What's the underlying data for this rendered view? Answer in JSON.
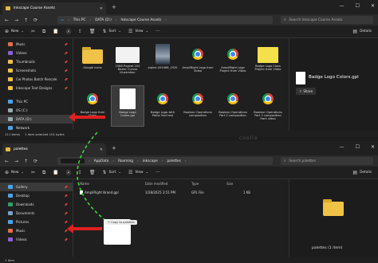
{
  "window1": {
    "tab_title": "Inkscape Course Assets",
    "breadcrumb": [
      "This PC",
      "DATA (D:)",
      "Inkscape Course Assets"
    ],
    "search_placeholder": "Search Inkscape Course Assets",
    "toolbar": {
      "new": "New",
      "sort": "Sort",
      "view": "View",
      "details": "Details"
    },
    "sidebar": [
      {
        "label": "Music",
        "icon": "music-folder-icon",
        "color": "#e36f46",
        "pinned": true
      },
      {
        "label": "Videos",
        "icon": "videos-folder-icon",
        "color": "#8a63d2",
        "pinned": true
      },
      {
        "label": "Thumbnails",
        "icon": "folder-icon",
        "color": "#f0c346",
        "pinned": true
      },
      {
        "label": "Screenshots",
        "icon": "folder-icon",
        "color": "#f0c346",
        "pinned": true
      },
      {
        "label": "Cw Photos Batch Rescale",
        "icon": "folder-icon",
        "color": "#f0c346",
        "pinned": true
      },
      {
        "label": "Inkscape Text Designs",
        "icon": "folder-icon",
        "color": "#f0c346",
        "pinned": true
      },
      {
        "label": "",
        "icon": "",
        "color": "",
        "pinned": false
      },
      {
        "label": "This PC",
        "icon": "pc-icon",
        "color": "#4aa3e8",
        "pinned": false
      },
      {
        "label": "OS (C:)",
        "icon": "drive-icon",
        "color": "#9aa",
        "pinned": false
      },
      {
        "label": "DATA (D:)",
        "icon": "drive-icon",
        "color": "#9aa",
        "pinned": false,
        "selected": true
      },
      {
        "label": "Network",
        "icon": "network-icon",
        "color": "#4aa3e8",
        "pinned": false
      }
    ],
    "files": [
      {
        "name": "Google Icons",
        "type": "folder",
        "selected": false
      },
      {
        "name": "1968 Pugeot 204 Bezier Curves Illustration",
        "type": "paper",
        "selected": false
      },
      {
        "name": "alpine-455488_1920",
        "type": "photo",
        "selected": false
      },
      {
        "name": "AmpliRight Logo from Video",
        "type": "chrome",
        "selected": false
      },
      {
        "name": "AmpliRight Logo Project from Video",
        "type": "chrome",
        "selected": false
      },
      {
        "name": "Badge Logo Class Project from Video",
        "type": "badge",
        "selected": false
      },
      {
        "name": "Badge Logo from Video",
        "type": "chrome",
        "selected": false
      },
      {
        "name": "Badge Logo Colors.gpl",
        "type": "doc",
        "selected": true
      },
      {
        "name": "Badge Logo with Paths Text test",
        "type": "chrome",
        "selected": false
      },
      {
        "name": "Boolean Operations composition",
        "type": "chrome",
        "selected": false
      },
      {
        "name": "Boolean Operations Part 2 composition",
        "type": "chrome",
        "selected": false
      },
      {
        "name": "Boolean Operations Part 2 composition from video",
        "type": "chrome",
        "selected": false
      }
    ],
    "preview": {
      "filename": "Badge Logo Colors.gpl",
      "share": "Share"
    },
    "status": {
      "items": "111 items",
      "selected": "1 item selected 101 bytes"
    }
  },
  "window2": {
    "tab_title": "palettes",
    "breadcrumb": [
      "AppData",
      "Roaming",
      "inkscape",
      "palettes"
    ],
    "search_placeholder": "Search palettes",
    "toolbar": {
      "new": "New",
      "sort": "Sort",
      "view": "View",
      "details": "Details"
    },
    "sidebar": [
      {
        "label": "Gallery",
        "icon": "gallery-icon",
        "color": "#4aa3e8",
        "selected": true
      },
      {
        "label": "Desktop",
        "icon": "desktop-icon",
        "color": "#4aa3e8"
      },
      {
        "label": "Downloads",
        "icon": "downloads-icon",
        "color": "#2e9e6b"
      },
      {
        "label": "Documents",
        "icon": "documents-icon",
        "color": "#7aa2c8"
      },
      {
        "label": "Pictures",
        "icon": "pictures-icon",
        "color": "#4aa3e8"
      },
      {
        "label": "Music",
        "icon": "music-folder-icon",
        "color": "#e36f46"
      },
      {
        "label": "Videos",
        "icon": "videos-folder-icon",
        "color": "#8a63d2"
      }
    ],
    "columns": [
      "Name",
      "Date modified",
      "Type",
      "Size"
    ],
    "rows": [
      {
        "name": "AmpliRight Brand.gpl",
        "date": "1/28/2025 3:51 PM",
        "type": "GPL File",
        "size": "1 KB"
      }
    ],
    "copy_tooltip": "+ Copy to palettes",
    "preview": {
      "caption": "palettes (1 item)"
    },
    "status": {
      "items": "1 item"
    }
  },
  "watermark": "coolio"
}
